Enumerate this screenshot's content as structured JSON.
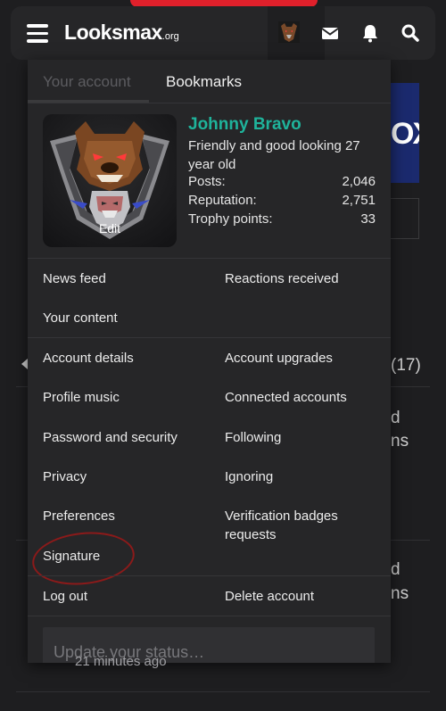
{
  "header": {
    "logo_main": "Lksmax",
    "logo_o": "oo",
    "logo_org": ".org"
  },
  "tabs": {
    "your_account": "Your account",
    "bookmarks": "Bookmarks"
  },
  "profile": {
    "edit": "Edit",
    "username": "Johnny Bravo",
    "title": "Friendly and good looking 27 year old",
    "stats": [
      {
        "label": "Posts:",
        "value": "2,046"
      },
      {
        "label": "Reputation:",
        "value": "2,751"
      },
      {
        "label": "Trophy points:",
        "value": "33"
      }
    ]
  },
  "menu": {
    "news_feed": "News feed",
    "reactions_received": "Reactions received",
    "your_content": "Your content",
    "account_details": "Account details",
    "account_upgrades": "Account upgrades",
    "profile_music": "Profile music",
    "connected_accounts": "Connected accounts",
    "password_security": "Password and security",
    "following": "Following",
    "privacy": "Privacy",
    "ignoring": "Ignoring",
    "preferences": "Preferences",
    "verification_badges": "Verification badges requests",
    "signature": "Signature",
    "log_out": "Log out",
    "delete_account": "Delete account"
  },
  "status": {
    "placeholder": "Update your status…"
  },
  "background": {
    "banner_text": "OX",
    "count": "(17)",
    "frag1": "d",
    "frag2": "ns",
    "frag3": "d",
    "frag4": "ns",
    "ago": "21 minutes ago"
  },
  "colors": {
    "accent_username": "#1fb39b",
    "annotation": "#8b1a1a",
    "brand_red": "#e0202b"
  }
}
